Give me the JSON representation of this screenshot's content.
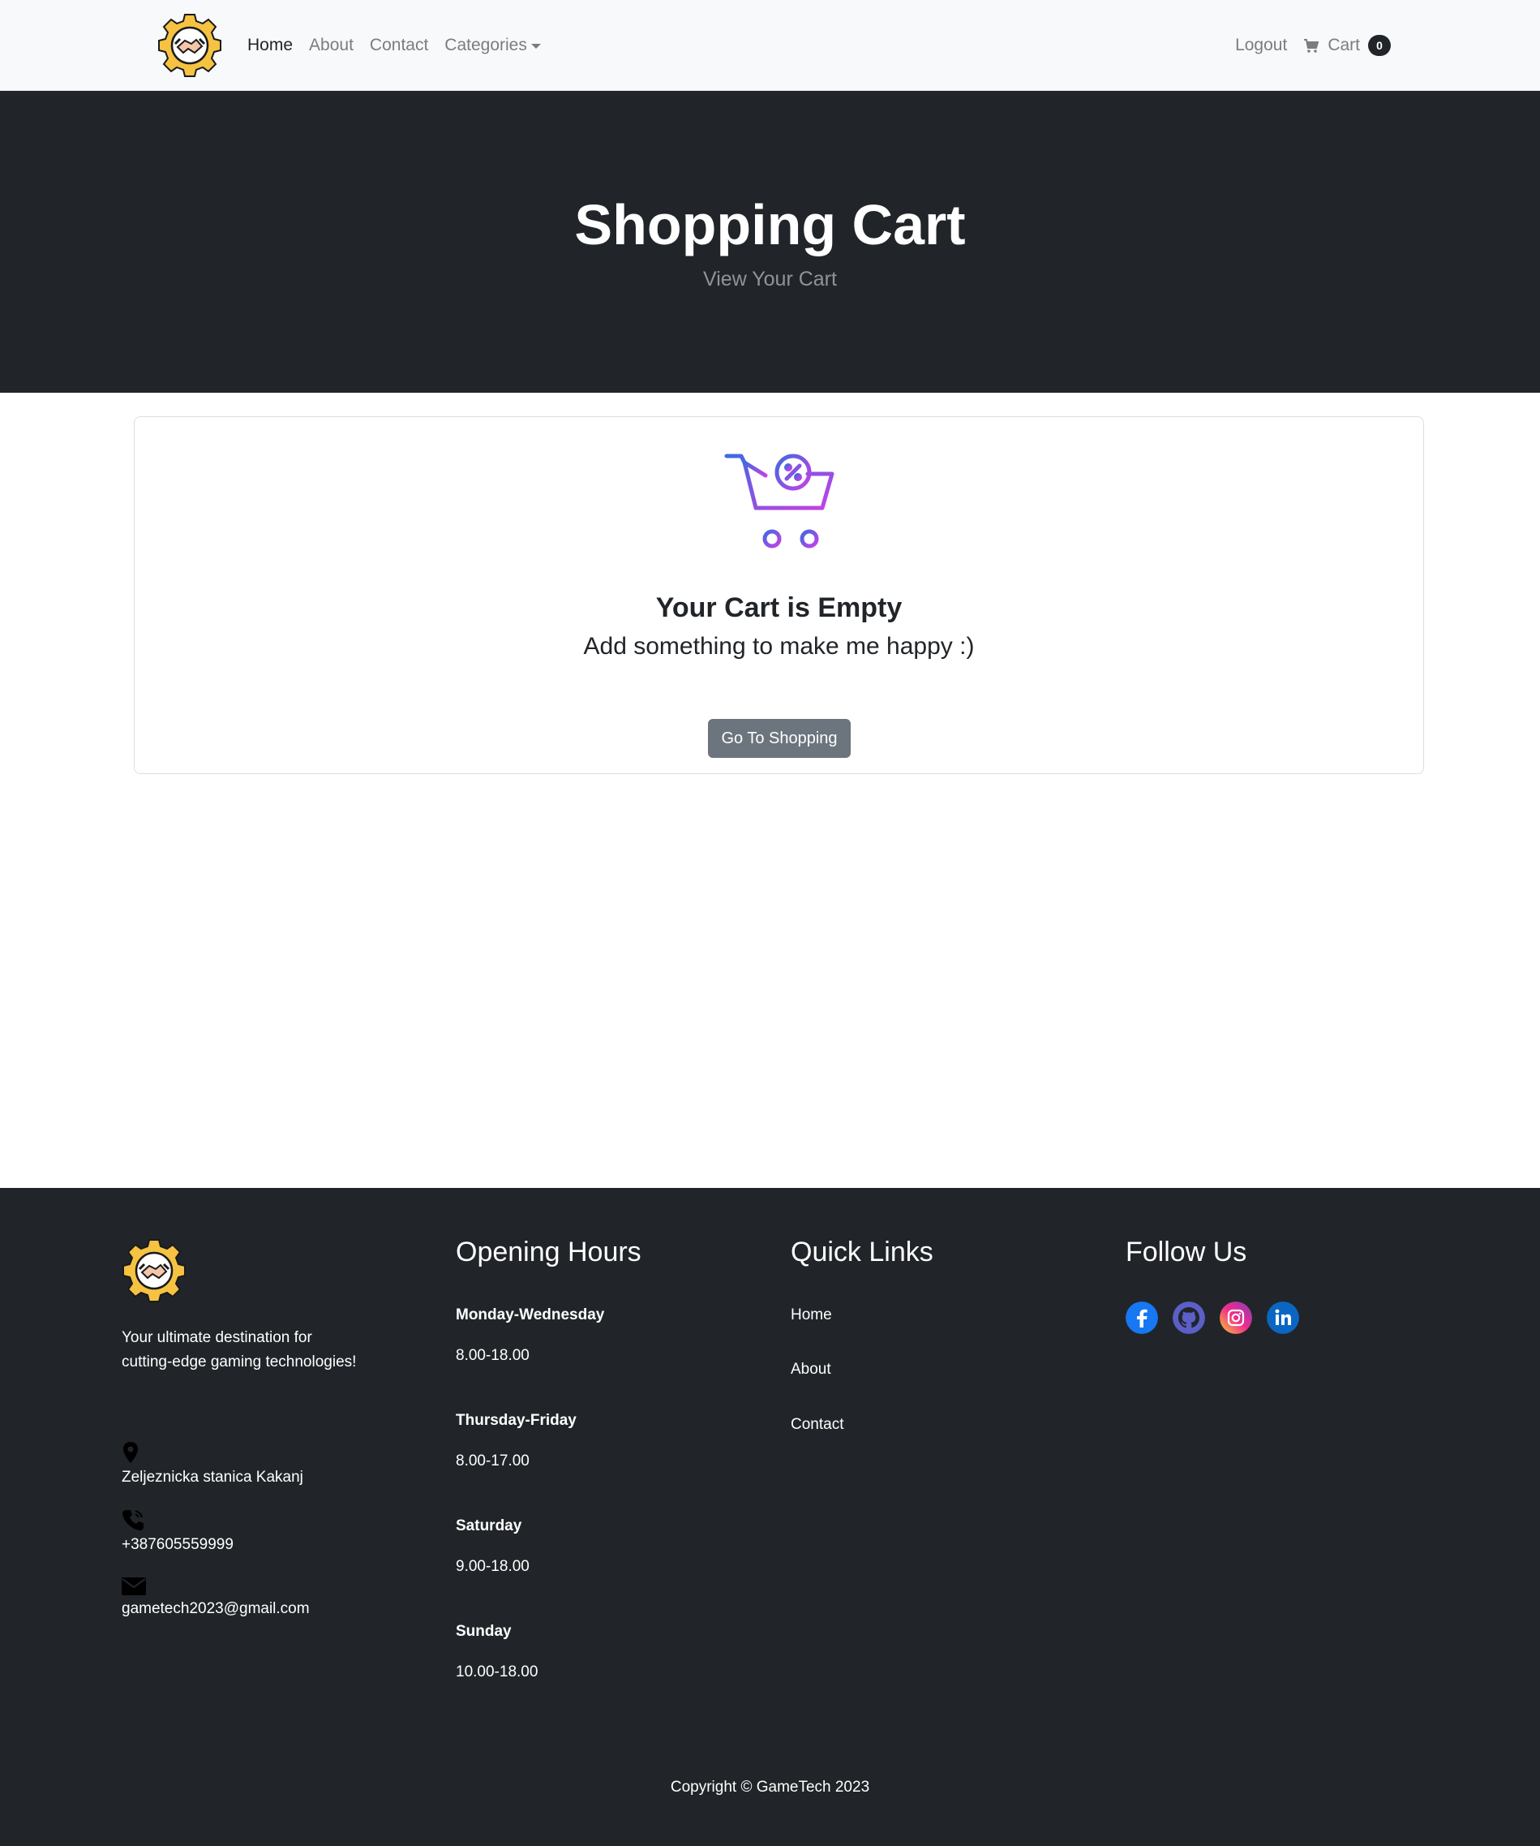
{
  "nav": {
    "links": [
      "Home",
      "About",
      "Contact",
      "Categories"
    ],
    "logout": "Logout",
    "cart": "Cart",
    "cart_count": "0"
  },
  "hero": {
    "title": "Shopping Cart",
    "subtitle": "View Your Cart"
  },
  "cart": {
    "empty_title": "Your Cart is Empty",
    "empty_subtitle": "Add something to make me happy :)",
    "button": "Go To Shopping"
  },
  "footer": {
    "tagline_line1": "Your ultimate destination for",
    "tagline_line2": "cutting-edge gaming technologies!",
    "address": "Zeljeznicka stanica Kakanj",
    "phone": "+387605559999",
    "email": "gametech2023@gmail.com",
    "opening_hours_title": "Opening Hours",
    "hours": [
      {
        "day": "Monday-Wednesday",
        "time": "8.00-18.00"
      },
      {
        "day": "Thursday-Friday",
        "time": "8.00-17.00"
      },
      {
        "day": "Saturday",
        "time": "9.00-18.00"
      },
      {
        "day": "Sunday",
        "time": "10.00-18.00"
      }
    ],
    "quick_links_title": "Quick Links",
    "quick_links": [
      "Home",
      "About",
      "Contact"
    ],
    "follow_title": "Follow Us",
    "social_icons": [
      "facebook-icon",
      "github-icon",
      "instagram-icon",
      "linkedin-icon"
    ],
    "copyright": "Copyright © GameTech 2023"
  },
  "colors": {
    "dark": "#212529",
    "navbar_bg": "#f8f9fa",
    "button_bg": "#6c757d",
    "logo_gold": "#f5c242"
  }
}
